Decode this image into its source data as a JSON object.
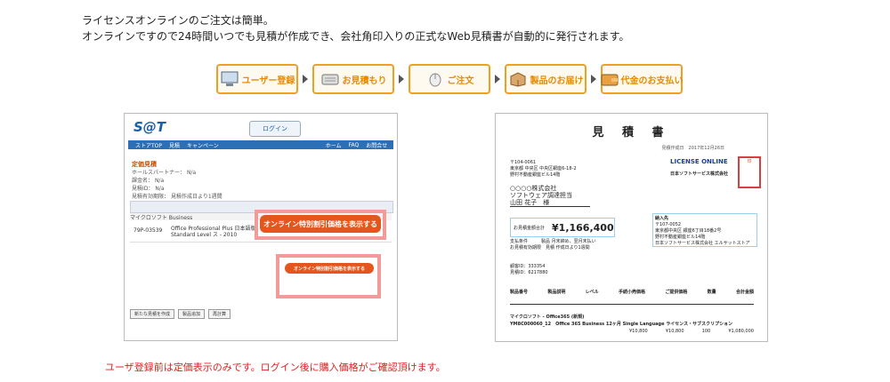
{
  "intro": {
    "line1": "ライセンスオンラインのご注文は簡単。",
    "line2": "オンラインですので24時間いつでも見積が作成でき、会社角印入りの正式なWeb見積書が自動的に発行されます。"
  },
  "steps": [
    {
      "label": "ユーザー登録",
      "icon": "computer-icon"
    },
    {
      "label": "お見積もり",
      "icon": "keyboard-icon"
    },
    {
      "label": "ご注文",
      "icon": "mouse-icon"
    },
    {
      "label": "製品のお届け",
      "icon": "box-icon"
    },
    {
      "label": "代金のお支払い",
      "icon": "wallet-icon"
    }
  ],
  "shot": {
    "logo": "S@T",
    "login": "ログイン",
    "nav": [
      "ストアTOP",
      "見積",
      "キャンペーン",
      "ホーム",
      "FAQ",
      "お問合せ"
    ],
    "section_title": "定価見積",
    "info": [
      "ホールスパートナー：",
      "N/a",
      "課金名：",
      "N/a",
      "見積ID：",
      "N/a",
      "見積有効期限：",
      "見積作成日より1週間"
    ],
    "group": "マイクロソフト Business",
    "product_code": "79P-03539",
    "product_name": "Office Professional Plus 日本語版 Standard Level ス - 2010",
    "overlay_btn1": "オンライン特別割引価格を表示する",
    "overlay_btn2": "オンライン特別割引価格を表示する",
    "buttons": [
      "新たな見積を作成",
      "製品追加",
      "再計算"
    ]
  },
  "doc": {
    "title": "見 積 書",
    "date": "見積作成日　2017年12月26日",
    "address": [
      "〒104-0061",
      "東京都 中央区 中央区銀座6-18-2",
      "野村不動産銀座ビル14階"
    ],
    "client": [
      "○○○○株式会社",
      "ソフトウェア調達担当",
      "山田 花子　様"
    ],
    "license": "LICENSE ONLINE",
    "vendor": "日本ソフトサービス株式会社",
    "stamp": "印",
    "total_label": "お見積金額合計",
    "total_amount": "¥1,166,400",
    "dest": [
      "納入先",
      "〒107-0052",
      "東京都中央区 銀座6丁目18番2号",
      "野村不動産銀座ビル14階",
      "日本ソフトサービス株式会社 エルサットストア"
    ],
    "terms": [
      "支払条件　　　製品 月末締め、翌月末払い",
      "お見積有効期限　見積 作成日より1週間"
    ],
    "ids": [
      "顧客ID：333354",
      "見積ID：6217880"
    ],
    "cols": [
      "製品番号",
      "製品説明",
      "レベル",
      "手続小売価格",
      "ご提供価格",
      "数量",
      "合計金額"
    ],
    "item": [
      "マイクロソフト - Office365 (新規)",
      "YM8C000060_12　Office 365 Business 12ヶ月 Single Language ライセンス・サブスクリプション"
    ],
    "item_vals": [
      "¥10,800",
      "¥10,800",
      "100",
      "¥1,080,000"
    ]
  },
  "note": "ユーザ登録前は定価表示のみです。ログイン後に購入価格がご確認頂けます。"
}
